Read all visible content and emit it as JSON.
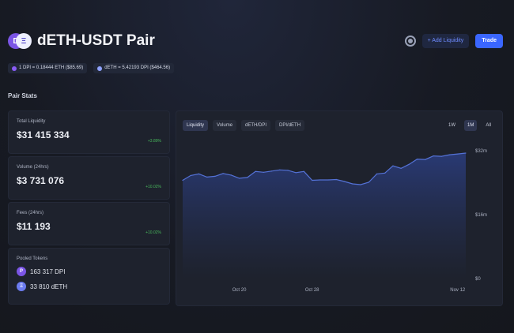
{
  "header": {
    "logo_text_a": "D",
    "logo_text_b": "Ξ",
    "title": "dETH-USDT Pair",
    "add_liquidity_label": "+ Add Liquidity",
    "trade_label": "Trade"
  },
  "prices": [
    {
      "text": "1 DPI = 0.18444 ETH ($85.69)",
      "color": "#8a5cf6"
    },
    {
      "text": "dETH = 5.42193 DPI ($464.56)",
      "color": "#8fa2ff"
    }
  ],
  "section_title": "Pair Stats",
  "stats": {
    "liquidity": {
      "label": "Total Liquidity",
      "value": "$31 415 334",
      "delta": "+3.89%"
    },
    "volume": {
      "label": "Volume (24hrs)",
      "value": "$3 731 076",
      "delta": "+10.02%"
    },
    "fees": {
      "label": "Fees (24hrs)",
      "value": "$11 193",
      "delta": "+10.02%"
    },
    "pooled": {
      "label": "Pooled Tokens",
      "token1": {
        "amount": "163 317 DPI",
        "icon": "P",
        "color": "#7b55e6"
      },
      "token2": {
        "amount": "33 810 dETH",
        "icon": "Ξ",
        "color": "#6c7cf0"
      }
    }
  },
  "chart_tabs": [
    "Liquidity",
    "Volume",
    "dETH/DPI",
    "DPI/dETH"
  ],
  "chart_ranges": [
    "1W",
    "1M",
    "All"
  ],
  "chart_data": {
    "type": "area",
    "x": [
      0,
      1,
      2,
      3,
      4,
      5,
      6,
      7,
      8,
      9,
      10,
      11,
      12,
      13,
      14,
      15,
      16,
      17,
      18,
      19,
      20,
      21,
      22,
      23,
      24,
      25,
      26,
      27,
      28,
      29,
      30,
      31,
      32,
      33,
      34,
      35
    ],
    "values": [
      24.6,
      25.8,
      26.2,
      25.4,
      25.6,
      26.3,
      25.9,
      25.1,
      25.3,
      26.8,
      26.6,
      26.9,
      27.2,
      27.1,
      26.5,
      26.8,
      24.6,
      24.7,
      24.7,
      24.8,
      24.3,
      23.7,
      23.5,
      24.1,
      26.2,
      26.4,
      28.2,
      27.6,
      28.6,
      29.9,
      29.8,
      30.7,
      30.6,
      31.0,
      31.2,
      31.4
    ],
    "x_ticks": [
      {
        "x": 7,
        "label": "Oct 20"
      },
      {
        "x": 16,
        "label": "Oct 28"
      },
      {
        "x": 34,
        "label": "Nov 12"
      }
    ],
    "y_ticks": [
      {
        "y": 32,
        "label": "$32m"
      },
      {
        "y": 16,
        "label": "$16m"
      },
      {
        "y": 0,
        "label": "$0"
      }
    ],
    "ylim": [
      0,
      32
    ],
    "line_color": "#5472d6",
    "fill_color": "#2a3b78"
  }
}
